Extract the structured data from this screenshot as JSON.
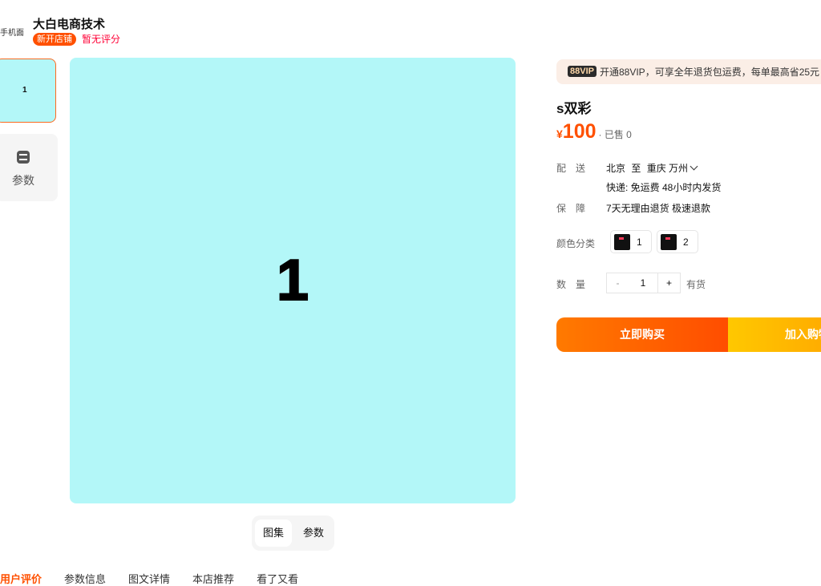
{
  "header": {
    "left_tag": "手机面",
    "shop_name": "大白电商技术",
    "shop_badge": "新开店铺",
    "rating": "暂无评分"
  },
  "thumbnails": {
    "first_label": "1",
    "params_label": "参数"
  },
  "main_image": {
    "label": "1",
    "background": "#b3f7f8"
  },
  "gallery_switch": {
    "tabs": [
      "图集",
      "参数"
    ],
    "active": "图集"
  },
  "bottom_tabs": [
    "用户评价",
    "参数信息",
    "图文详情",
    "本店推荐",
    "看了又看"
  ],
  "vip": {
    "badge": "88VIP",
    "text": "开通88VIP，可享全年退货包运费，每单最高省25元"
  },
  "product": {
    "title": "s双彩",
    "price_symbol": "¥",
    "price": "100",
    "sold": "· 已售 0"
  },
  "delivery": {
    "label": "配　送",
    "from": "北京",
    "to_word": "至",
    "to": "重庆 万州",
    "detail": "快递: 免运费  48小时内发货"
  },
  "guarantee": {
    "label": "保　障",
    "text": "7天无理由退货 极速退款"
  },
  "color": {
    "label": "颜色分类",
    "options": [
      "1",
      "2"
    ]
  },
  "quantity": {
    "label": "数　量",
    "minus": "-",
    "value": "1",
    "plus": "+",
    "stock": "有货"
  },
  "actions": {
    "buy_now": "立即购买",
    "add_cart": "加入购物车"
  },
  "colors": {
    "accent": "#ff5000",
    "image_bg": "#b3f7f8",
    "cart": "#ffc800"
  }
}
